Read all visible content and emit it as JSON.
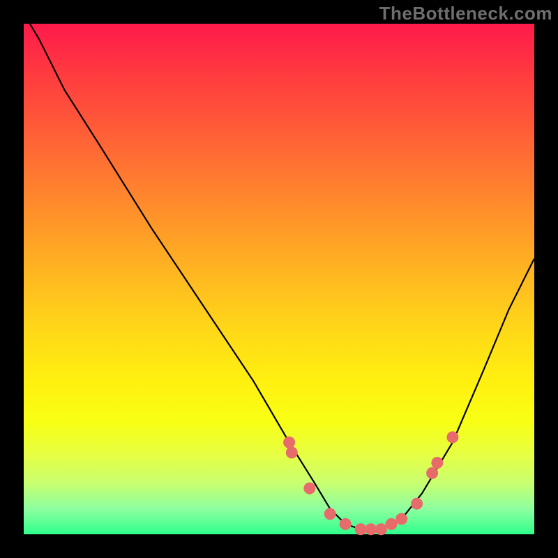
{
  "brand": "TheBottleneck.com",
  "colors": {
    "page_bg": "#000000",
    "brand_text": "#6e6e6e",
    "curve": "#000000",
    "dot": "#e86b6b",
    "gradient_top": "#ff1a4b",
    "gradient_bottom": "#2fff8c"
  },
  "chart_data": {
    "type": "line",
    "title": "",
    "xlabel": "",
    "ylabel": "",
    "xlim": [
      0,
      100
    ],
    "ylim": [
      0,
      100
    ],
    "grid": false,
    "legend": false,
    "annotations": [],
    "series": [
      {
        "name": "curve",
        "x": [
          0,
          3,
          8,
          15,
          25,
          35,
          45,
          52,
          57,
          60,
          63,
          66,
          70,
          74,
          78,
          84,
          90,
          95,
          100
        ],
        "y": [
          102,
          97,
          87,
          76,
          60,
          45,
          30,
          18,
          10,
          5,
          2,
          1,
          1,
          3,
          8,
          18,
          32,
          44,
          54
        ]
      }
    ],
    "markers": {
      "name": "dots",
      "x": [
        52,
        52.5,
        56,
        60,
        63,
        66,
        68,
        70,
        72,
        74,
        77,
        80,
        81,
        84
      ],
      "y": [
        18,
        16,
        9,
        4,
        2,
        1,
        1,
        1,
        2,
        3,
        6,
        12,
        14,
        19
      ]
    }
  }
}
